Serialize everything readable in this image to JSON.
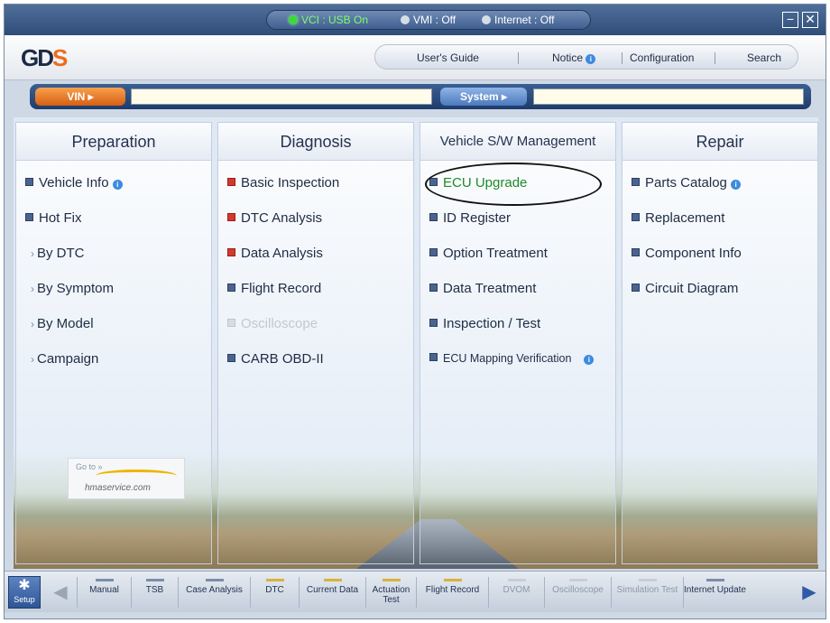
{
  "titlebar": {
    "vci": "VCI : USB On",
    "vmi": "VMI : Off",
    "internet": "Internet : Off",
    "minimize": "−",
    "close": "✕"
  },
  "header": {
    "logo": "GD",
    "logo_s": "S",
    "nav": [
      "User's Guide",
      "Notice",
      "Configuration",
      "Search"
    ]
  },
  "vinbar": {
    "vin_label": "VIN",
    "vin_value": "",
    "system_label": "System",
    "system_value": ""
  },
  "columns": [
    {
      "title": "Preparation",
      "items": [
        {
          "label": "Vehicle Info",
          "bullet": "blue",
          "info": true
        },
        {
          "label": "Hot Fix",
          "bullet": "blue"
        },
        {
          "label": "By DTC",
          "sub": true
        },
        {
          "label": "By Symptom",
          "sub": true
        },
        {
          "label": "By Model",
          "sub": true
        },
        {
          "label": "Campaign",
          "sub": true
        }
      ]
    },
    {
      "title": "Diagnosis",
      "items": [
        {
          "label": "Basic Inspection",
          "bullet": "red"
        },
        {
          "label": "DTC Analysis",
          "bullet": "red"
        },
        {
          "label": "Data Analysis",
          "bullet": "red"
        },
        {
          "label": "Flight Record",
          "bullet": "blue"
        },
        {
          "label": "Oscilloscope",
          "bullet": "gray",
          "disabled": true
        },
        {
          "label": "CARB OBD-II",
          "bullet": "blue"
        }
      ]
    },
    {
      "title": "Vehicle S/W Management",
      "items": [
        {
          "label": "ECU Upgrade",
          "bullet": "blue",
          "highlight": true
        },
        {
          "label": "ID Register",
          "bullet": "blue"
        },
        {
          "label": "Option Treatment",
          "bullet": "blue"
        },
        {
          "label": "Data Treatment",
          "bullet": "blue"
        },
        {
          "label": "Inspection / Test",
          "bullet": "blue"
        },
        {
          "label": "ECU Mapping Verification",
          "bullet": "blue",
          "info": true,
          "small": true
        }
      ]
    },
    {
      "title": "Repair",
      "items": [
        {
          "label": "Parts Catalog",
          "bullet": "blue",
          "info": true
        },
        {
          "label": "Replacement",
          "bullet": "blue"
        },
        {
          "label": "Component Info",
          "bullet": "blue"
        },
        {
          "label": "Circuit Diagram",
          "bullet": "blue"
        }
      ]
    }
  ],
  "promo": {
    "goto": "Go to »",
    "site": "hmaservice.com"
  },
  "toolbar": {
    "setup": "Setup",
    "tools": [
      {
        "label": "Manual",
        "state": "normal"
      },
      {
        "label": "TSB",
        "state": "normal"
      },
      {
        "label": "Case Analysis",
        "state": "normal"
      },
      {
        "label": "DTC",
        "state": "yellow"
      },
      {
        "label": "Current Data",
        "state": "yellow"
      },
      {
        "label": "Actuation Test",
        "state": "yellow"
      },
      {
        "label": "Flight Record",
        "state": "yellow"
      },
      {
        "label": "DVOM",
        "state": "disabled"
      },
      {
        "label": "Oscilloscope",
        "state": "disabled"
      },
      {
        "label": "Simulation Test",
        "state": "disabled"
      },
      {
        "label": "Internet Update",
        "state": "normal"
      }
    ]
  },
  "colors": {
    "accent": "#2e5595",
    "vin_orange": "#d65f13",
    "highlight_green": "#1f8a2a"
  }
}
